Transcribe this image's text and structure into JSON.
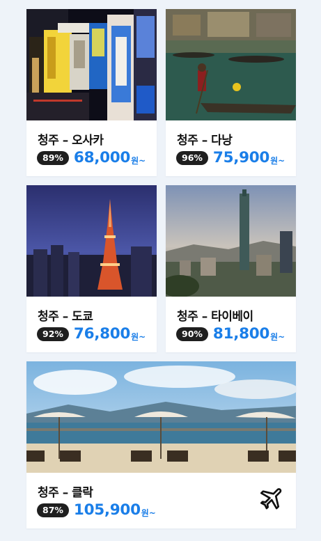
{
  "accent_color": "#1a7ee8",
  "deals": [
    {
      "route": "청주 – 오사카",
      "discount": "89%",
      "price": "68,000",
      "price_suffix": "원~",
      "image": "osaka-dotonbori-signs"
    },
    {
      "route": "청주 – 다낭",
      "discount": "96%",
      "price": "75,900",
      "price_suffix": "원~",
      "image": "danang-river-boat"
    },
    {
      "route": "청주 – 도쿄",
      "discount": "92%",
      "price": "76,800",
      "price_suffix": "원~",
      "image": "tokyo-tower-night"
    },
    {
      "route": "청주 – 타이베이",
      "discount": "90%",
      "price": "81,800",
      "price_suffix": "원~",
      "image": "taipei-101-skyline"
    },
    {
      "route": "청주 – 클락",
      "discount": "87%",
      "price": "105,900",
      "price_suffix": "원~",
      "image": "clark-beach-umbrellas",
      "icon": "airplane-icon"
    }
  ]
}
